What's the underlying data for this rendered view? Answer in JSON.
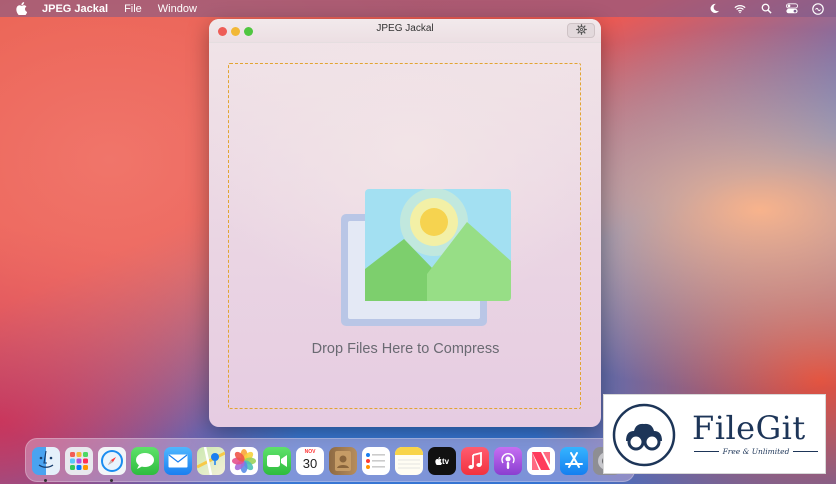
{
  "menubar": {
    "app_name": "JPEG Jackal",
    "menus": [
      "File",
      "Window"
    ],
    "status_icons": [
      "moon-icon",
      "wifi-icon",
      "search-icon",
      "control-center-icon",
      "siri-icon"
    ]
  },
  "window": {
    "title": "JPEG Jackal",
    "drop_text": "Drop Files Here to Compress",
    "accent_color": "#e2a432"
  },
  "dock": {
    "calendar_month": "NOV",
    "calendar_day": "30",
    "tv_label": "tv",
    "apps": [
      "Finder",
      "Launchpad",
      "Safari",
      "Messages",
      "Mail",
      "Maps",
      "Photos",
      "FaceTime",
      "Calendar",
      "Contacts",
      "Reminders",
      "Notes",
      "TV",
      "Music",
      "Podcasts",
      "News",
      "App Store",
      "System Preferences"
    ]
  },
  "watermark": {
    "name": "FileGit",
    "tagline": "Free & Unlimited"
  }
}
